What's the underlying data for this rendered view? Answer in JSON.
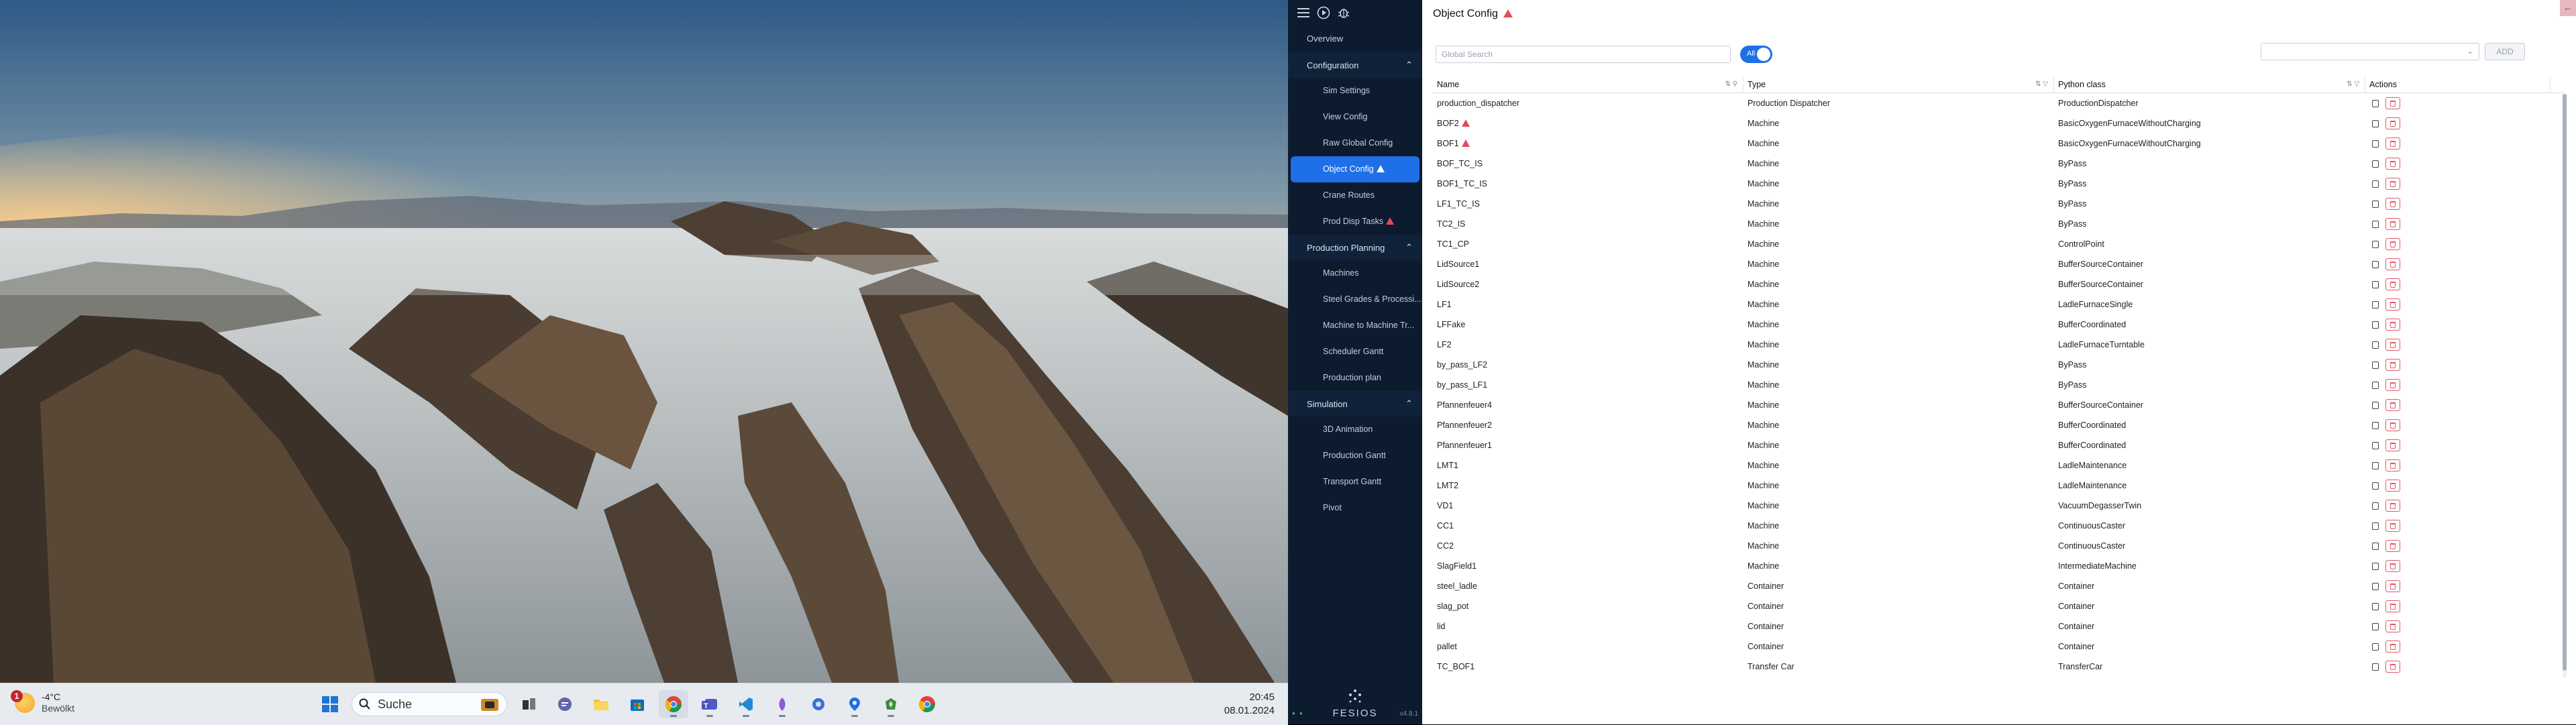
{
  "taskbar": {
    "weather": {
      "temp": "-4°C",
      "condition": "Bewölkt",
      "badge": "1"
    },
    "search_label": "Suche",
    "clock": {
      "time": "20:45",
      "date": "08.01.2024"
    }
  },
  "sidebar": {
    "overview": "Overview",
    "sections": [
      {
        "label": "Configuration",
        "items": [
          "Sim Settings",
          "View Config",
          "Raw Global Config",
          "Object Config",
          "Crane Routes",
          "Prod Disp Tasks"
        ]
      },
      {
        "label": "Production Planning",
        "items": [
          "Machines",
          "Steel Grades & Processi...",
          "Machine to Machine Tr...",
          "Scheduler Gantt",
          "Production plan"
        ]
      },
      {
        "label": "Simulation",
        "items": [
          "3D Animation",
          "Production Gantt",
          "Transport Gantt",
          "Pivot"
        ]
      }
    ],
    "logo": "FESIOS",
    "version": "v4.8.1"
  },
  "page": {
    "title": "Object Config",
    "search_placeholder": "Global Search",
    "toggle_label": "All",
    "add_button": "ADD",
    "columns": [
      "Name",
      "Type",
      "Python class",
      "Actions"
    ],
    "rows": [
      {
        "name": "production_dispatcher",
        "type": "Production Dispatcher",
        "cls": "ProductionDispatcher"
      },
      {
        "name": "BOF2",
        "type": "Machine",
        "cls": "BasicOxygenFurnaceWithoutCharging"
      },
      {
        "name": "BOF1",
        "type": "Machine",
        "cls": "BasicOxygenFurnaceWithoutCharging"
      },
      {
        "name": "BOF_TC_IS",
        "type": "Machine",
        "cls": "ByPass"
      },
      {
        "name": "BOF1_TC_IS",
        "type": "Machine",
        "cls": "ByPass"
      },
      {
        "name": "LF1_TC_IS",
        "type": "Machine",
        "cls": "ByPass"
      },
      {
        "name": "TC2_IS",
        "type": "Machine",
        "cls": "ByPass"
      },
      {
        "name": "TC1_CP",
        "type": "Machine",
        "cls": "ControlPoint"
      },
      {
        "name": "LidSource1",
        "type": "Machine",
        "cls": "BufferSourceContainer"
      },
      {
        "name": "LidSource2",
        "type": "Machine",
        "cls": "BufferSourceContainer"
      },
      {
        "name": "LF1",
        "type": "Machine",
        "cls": "LadleFurnaceSingle"
      },
      {
        "name": "LFFake",
        "type": "Machine",
        "cls": "BufferCoordinated"
      },
      {
        "name": "LF2",
        "type": "Machine",
        "cls": "LadleFurnaceTurntable"
      },
      {
        "name": "by_pass_LF2",
        "type": "Machine",
        "cls": "ByPass"
      },
      {
        "name": "by_pass_LF1",
        "type": "Machine",
        "cls": "ByPass"
      },
      {
        "name": "Pfannenfeuer4",
        "type": "Machine",
        "cls": "BufferSourceContainer"
      },
      {
        "name": "Pfannenfeuer2",
        "type": "Machine",
        "cls": "BufferCoordinated"
      },
      {
        "name": "Pfannenfeuer1",
        "type": "Machine",
        "cls": "BufferCoordinated"
      },
      {
        "name": "LMT1",
        "type": "Machine",
        "cls": "LadleMaintenance"
      },
      {
        "name": "LMT2",
        "type": "Machine",
        "cls": "LadleMaintenance"
      },
      {
        "name": "VD1",
        "type": "Machine",
        "cls": "VacuumDegasserTwin"
      },
      {
        "name": "CC1",
        "type": "Machine",
        "cls": "ContinuousCaster"
      },
      {
        "name": "CC2",
        "type": "Machine",
        "cls": "ContinuousCaster"
      },
      {
        "name": "SlagField1",
        "type": "Machine",
        "cls": "IntermediateMachine"
      },
      {
        "name": "steel_ladle",
        "type": "Container",
        "cls": "Container"
      },
      {
        "name": "slag_pot",
        "type": "Container",
        "cls": "Container"
      },
      {
        "name": "lid",
        "type": "Container",
        "cls": "Container"
      },
      {
        "name": "pallet",
        "type": "Container",
        "cls": "Container"
      },
      {
        "name": "TC_BOF1",
        "type": "Transfer Car",
        "cls": "TransferCar"
      }
    ],
    "warning_rows": [
      1,
      2
    ],
    "warning_items": [
      "Object Config",
      "Prod Disp Tasks"
    ]
  },
  "colors": {
    "sidebar": "#0d1b2f",
    "accent": "#1e6fe8",
    "danger": "#e05a66"
  }
}
